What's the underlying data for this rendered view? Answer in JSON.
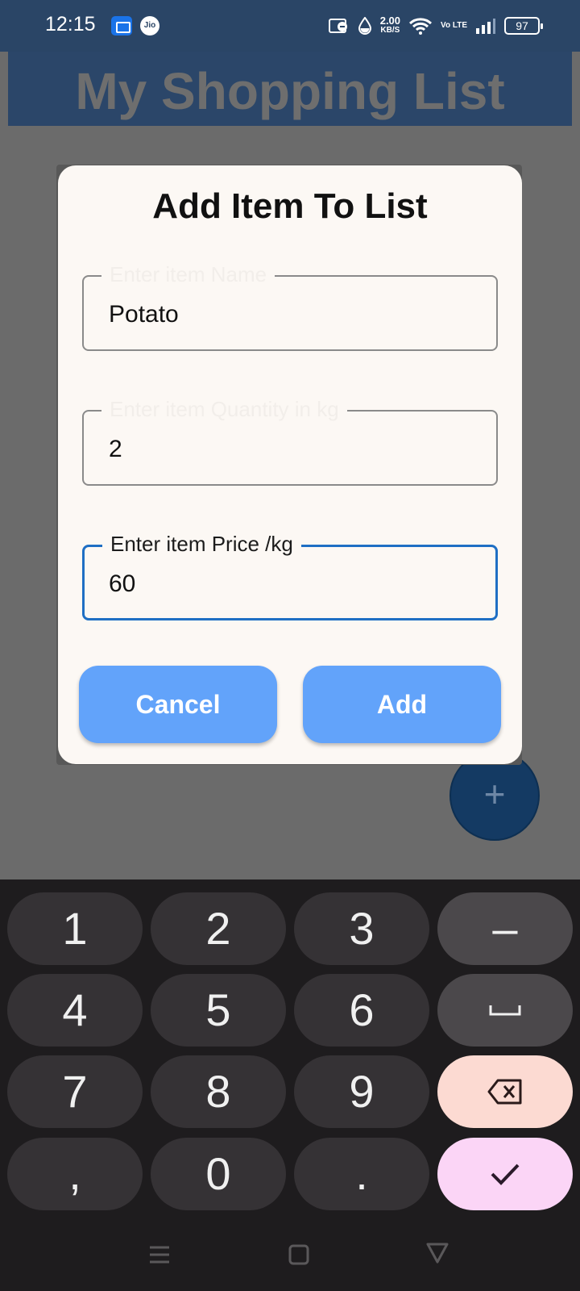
{
  "status_bar": {
    "time": "12:15",
    "network_speed": "2.00",
    "network_speed_unit": "KB/S",
    "volte": "Vo LTE",
    "battery": "97",
    "carrier_icon_text": "Jio"
  },
  "app": {
    "title": "My Shopping List",
    "fab_label": "+"
  },
  "dialog": {
    "title": "Add Item To List",
    "fields": [
      {
        "label": "Enter item Name",
        "value": "Potato",
        "focused": false
      },
      {
        "label": "Enter item Quantity in kg",
        "value": "2",
        "focused": false
      },
      {
        "label": "Enter item Price /kg",
        "value": "60",
        "focused": true
      }
    ],
    "cancel_label": "Cancel",
    "add_label": "Add"
  },
  "keyboard": {
    "rows": [
      [
        "1",
        "2",
        "3",
        "–"
      ],
      [
        "4",
        "5",
        "6",
        "space"
      ],
      [
        "7",
        "8",
        "9",
        "backspace"
      ],
      [
        ",",
        "0",
        ".",
        "done"
      ]
    ]
  },
  "colors": {
    "status_bar": "#2a4566",
    "button": "#62a3fa",
    "focus_border": "#1f6fc4",
    "dialog_bg": "#fcf8f4",
    "keyboard_bg": "#1e1c1e"
  }
}
